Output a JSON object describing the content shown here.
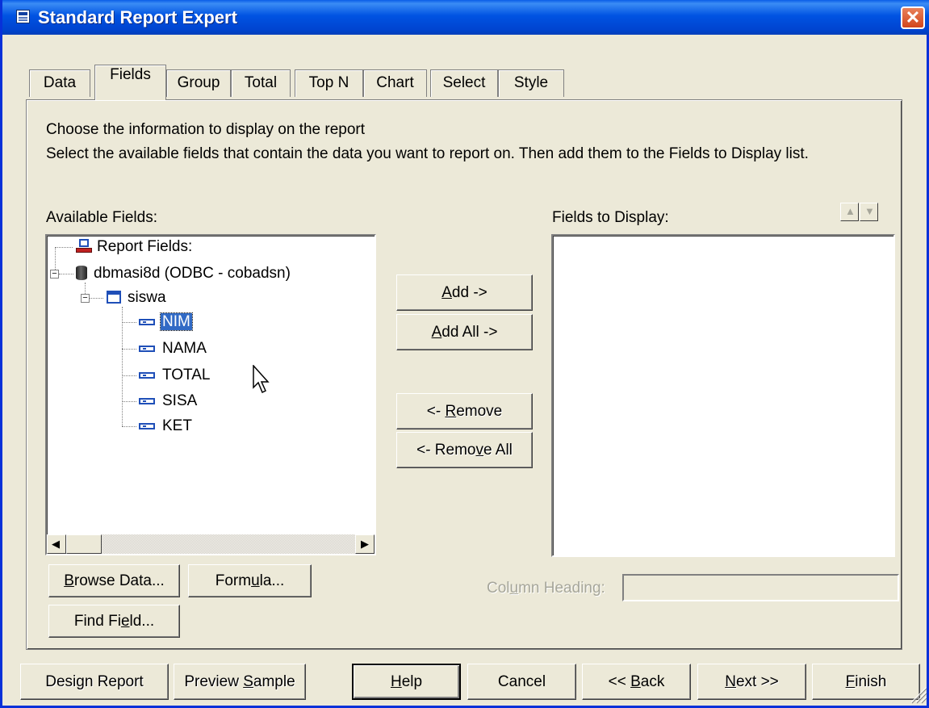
{
  "window": {
    "title": "Standard Report Expert",
    "close_icon": "close-icon"
  },
  "tabs": [
    {
      "label": "Data"
    },
    {
      "label": "Fields"
    },
    {
      "label": "Group"
    },
    {
      "label": "Total"
    },
    {
      "label": "Top N"
    },
    {
      "label": "Chart"
    },
    {
      "label": "Select"
    },
    {
      "label": "Style"
    }
  ],
  "fields_tab": {
    "heading": "Choose the information to display on the report",
    "instruction": "Select the available fields that contain the data you want to report on.  Then add them to the Fields to Display list.",
    "available_label": "Available Fields:",
    "display_label": "Fields to Display:",
    "tree": {
      "report_fields": "Report Fields:",
      "database": "dbmasi8d (ODBC - cobadsn)",
      "table": "siswa",
      "fields": [
        "NIM",
        "NAMA",
        "TOTAL",
        "SISA",
        "KET"
      ],
      "selected_field": "NIM"
    },
    "buttons": {
      "add": {
        "pre": "",
        "key": "A",
        "post": "dd ->"
      },
      "add_all": {
        "pre": "",
        "key": "A",
        "post": "dd All ->"
      },
      "remove": {
        "pre": "<- ",
        "key": "R",
        "post": "emove"
      },
      "remove_all": {
        "pre": "<- Remo",
        "key": "v",
        "post": "e All"
      },
      "browse": {
        "pre": "",
        "key": "B",
        "post": "rowse Data..."
      },
      "formula": {
        "pre": "Form",
        "key": "u",
        "post": "la..."
      },
      "find_field": {
        "pre": "Find Fi",
        "key": "e",
        "post": "ld..."
      }
    },
    "column_heading": {
      "pre": "Col",
      "key": "u",
      "post": "mn Heading:",
      "value": ""
    }
  },
  "footer": {
    "design_report": "Design Report",
    "preview": {
      "pre": "Preview ",
      "key": "S",
      "post": "ample"
    },
    "help": {
      "pre": "",
      "key": "H",
      "post": "elp"
    },
    "cancel": "Cancel",
    "back": {
      "pre": "<< ",
      "key": "B",
      "post": "ack"
    },
    "next": {
      "pre": "",
      "key": "N",
      "post": "ext >>"
    },
    "finish": {
      "pre": "",
      "key": "F",
      "post": "inish"
    }
  }
}
